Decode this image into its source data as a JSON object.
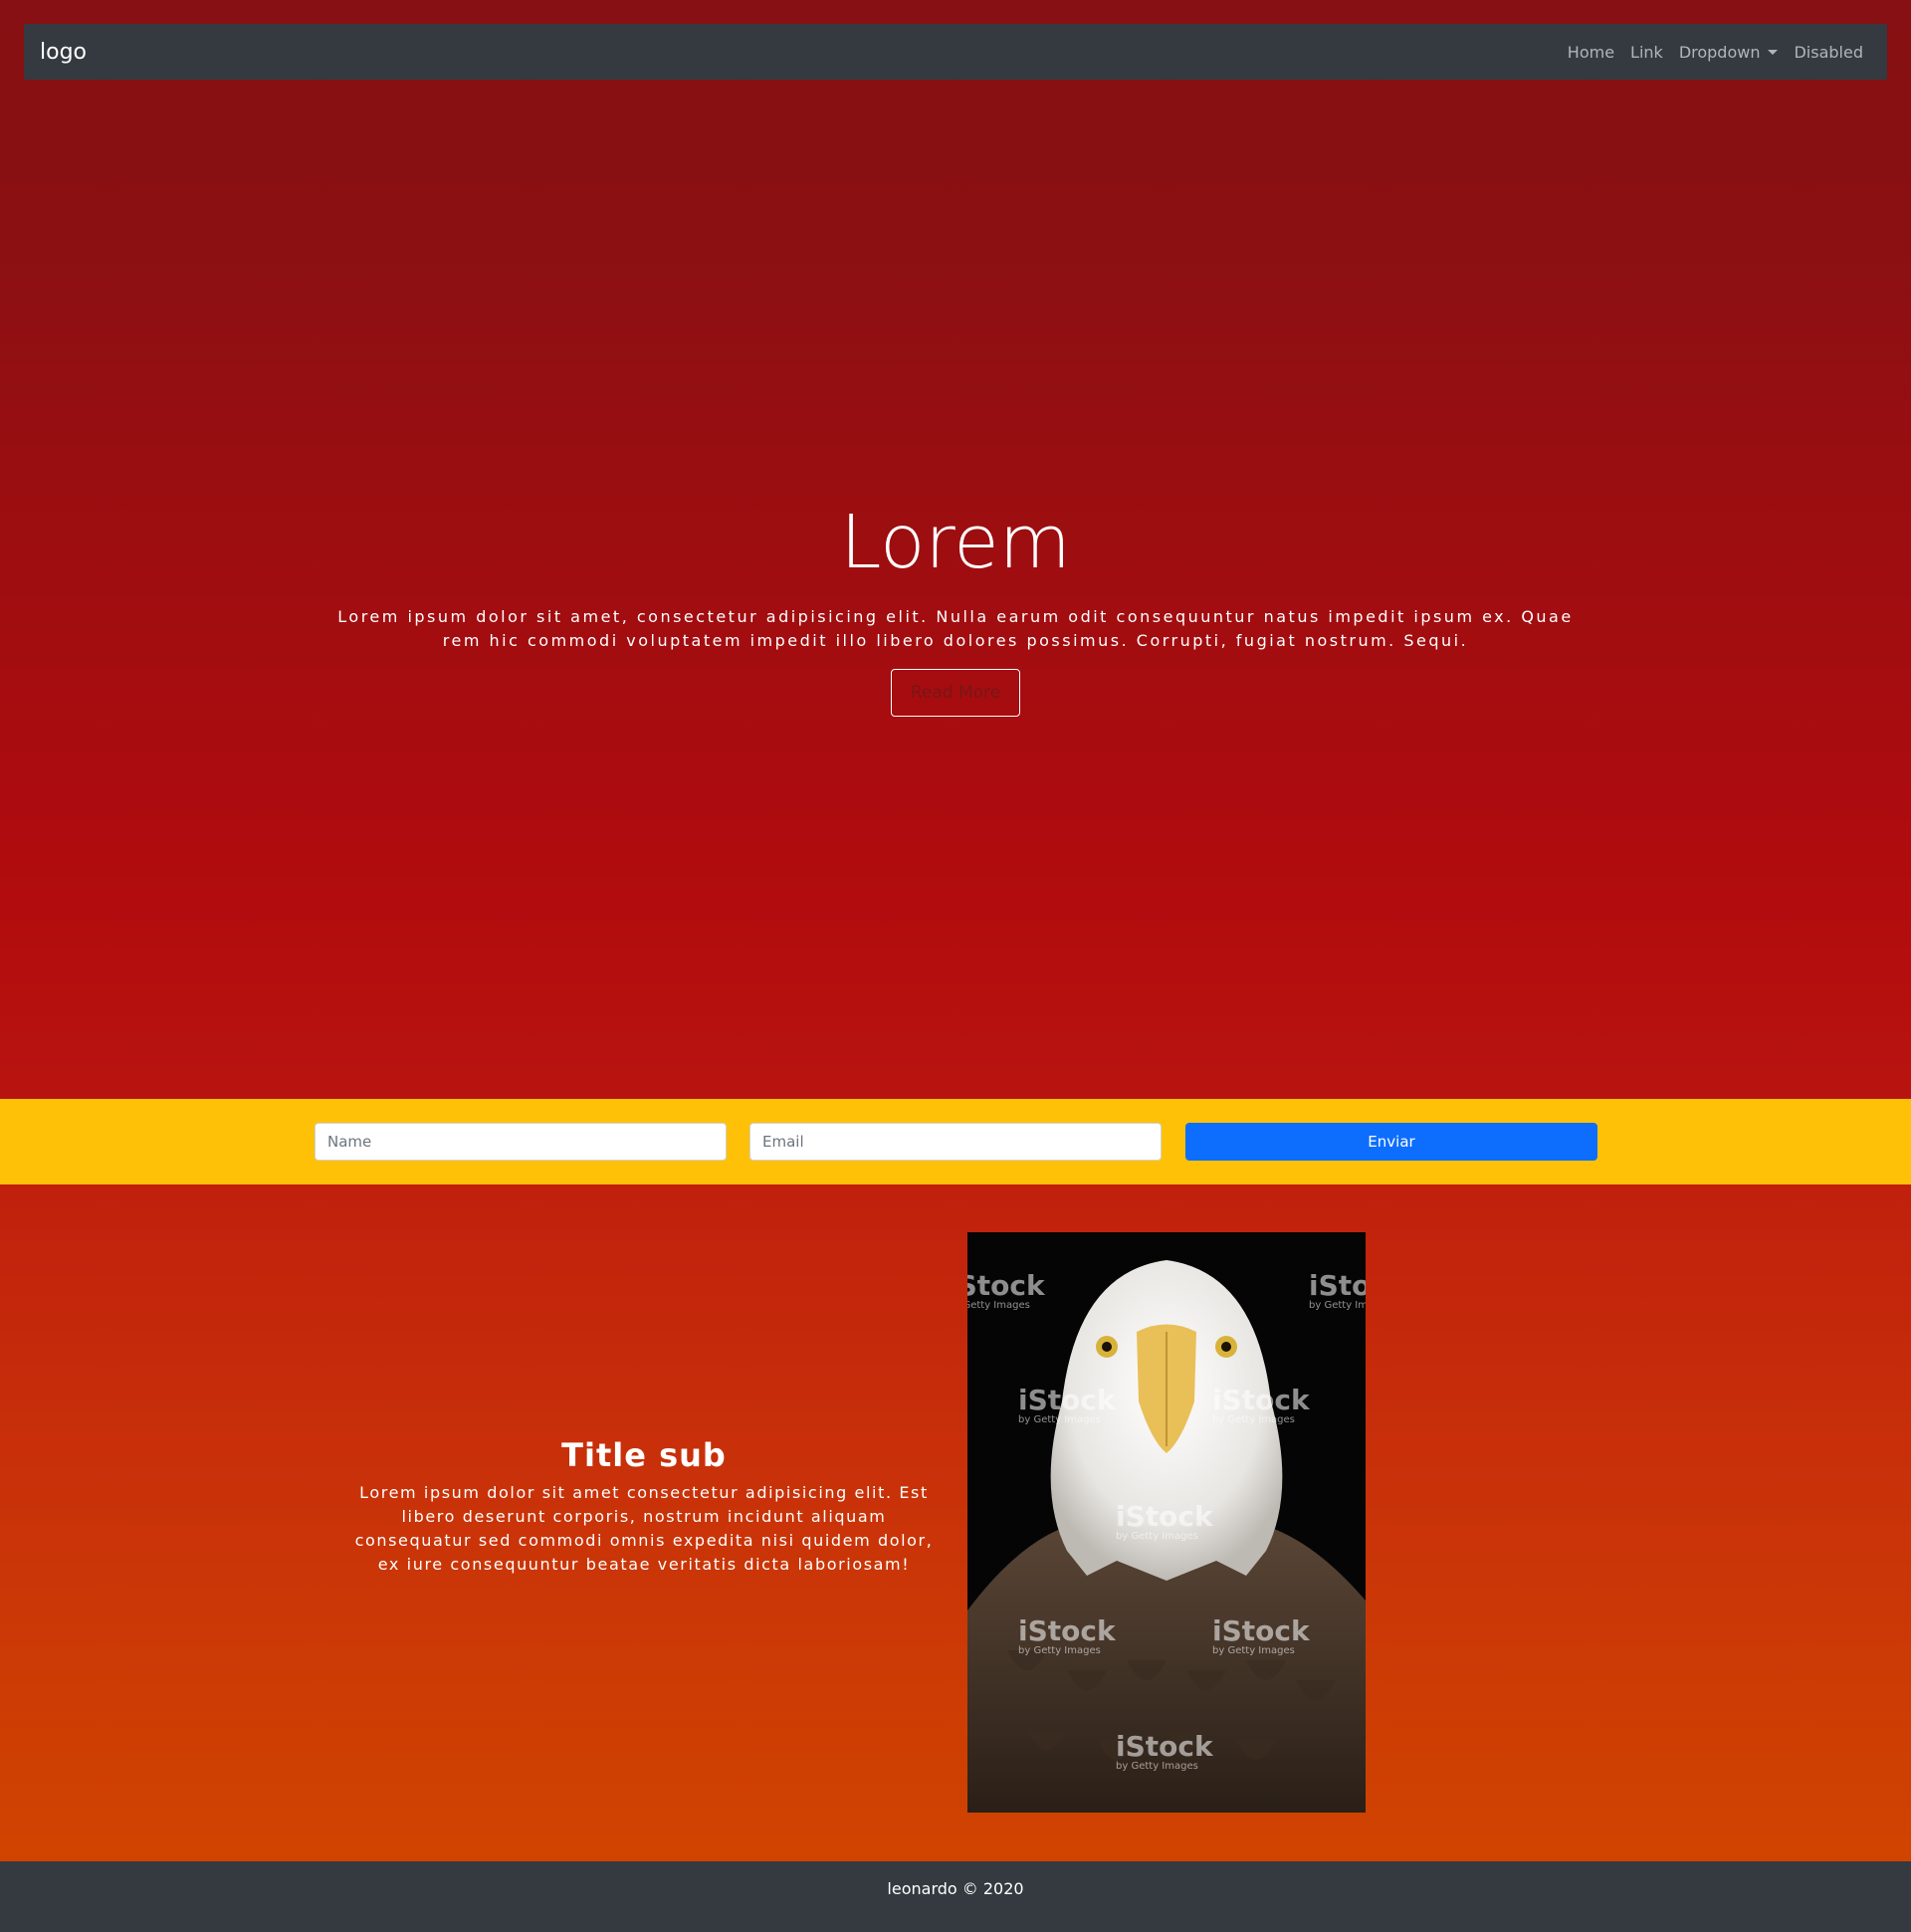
{
  "navbar": {
    "brand": "logo",
    "links": [
      {
        "label": "Home"
      },
      {
        "label": "Link"
      },
      {
        "label": "Dropdown"
      },
      {
        "label": "Disabled"
      }
    ]
  },
  "hero": {
    "title": "Lorem",
    "text": "Lorem ipsum dolor sit amet, consectetur adipisicing elit. Nulla earum odit consequuntur natus impedit ipsum ex. Quae rem hic commodi voluptatem impedit illo libero dolores possimus. Corrupti, fugiat nostrum. Sequi.",
    "button_label": "Read More"
  },
  "form": {
    "name_placeholder": "Name",
    "email_placeholder": "Email",
    "submit_label": "Enviar"
  },
  "feature": {
    "title": "Title sub",
    "text": "Lorem ipsum dolor sit amet consectetur adipisicing elit. Est libero deserunt corporis, nostrum incidunt aliquam consequatur sed commodi omnis expedita nisi quidem dolor, ex iure consequuntur beatae veritatis dicta laboriosam!",
    "image": {
      "watermark": "iStock",
      "watermark_sub": "by Getty Images"
    }
  },
  "footer": {
    "text": "leonardo © 2020"
  },
  "colors": {
    "hero_top": "#861013",
    "hero_bottom": "#b8140f",
    "form_band": "#ffc107",
    "primary": "#0d6efd",
    "navbar": "#343a40",
    "feature_top": "#c0200c",
    "feature_bottom": "#d04400"
  }
}
